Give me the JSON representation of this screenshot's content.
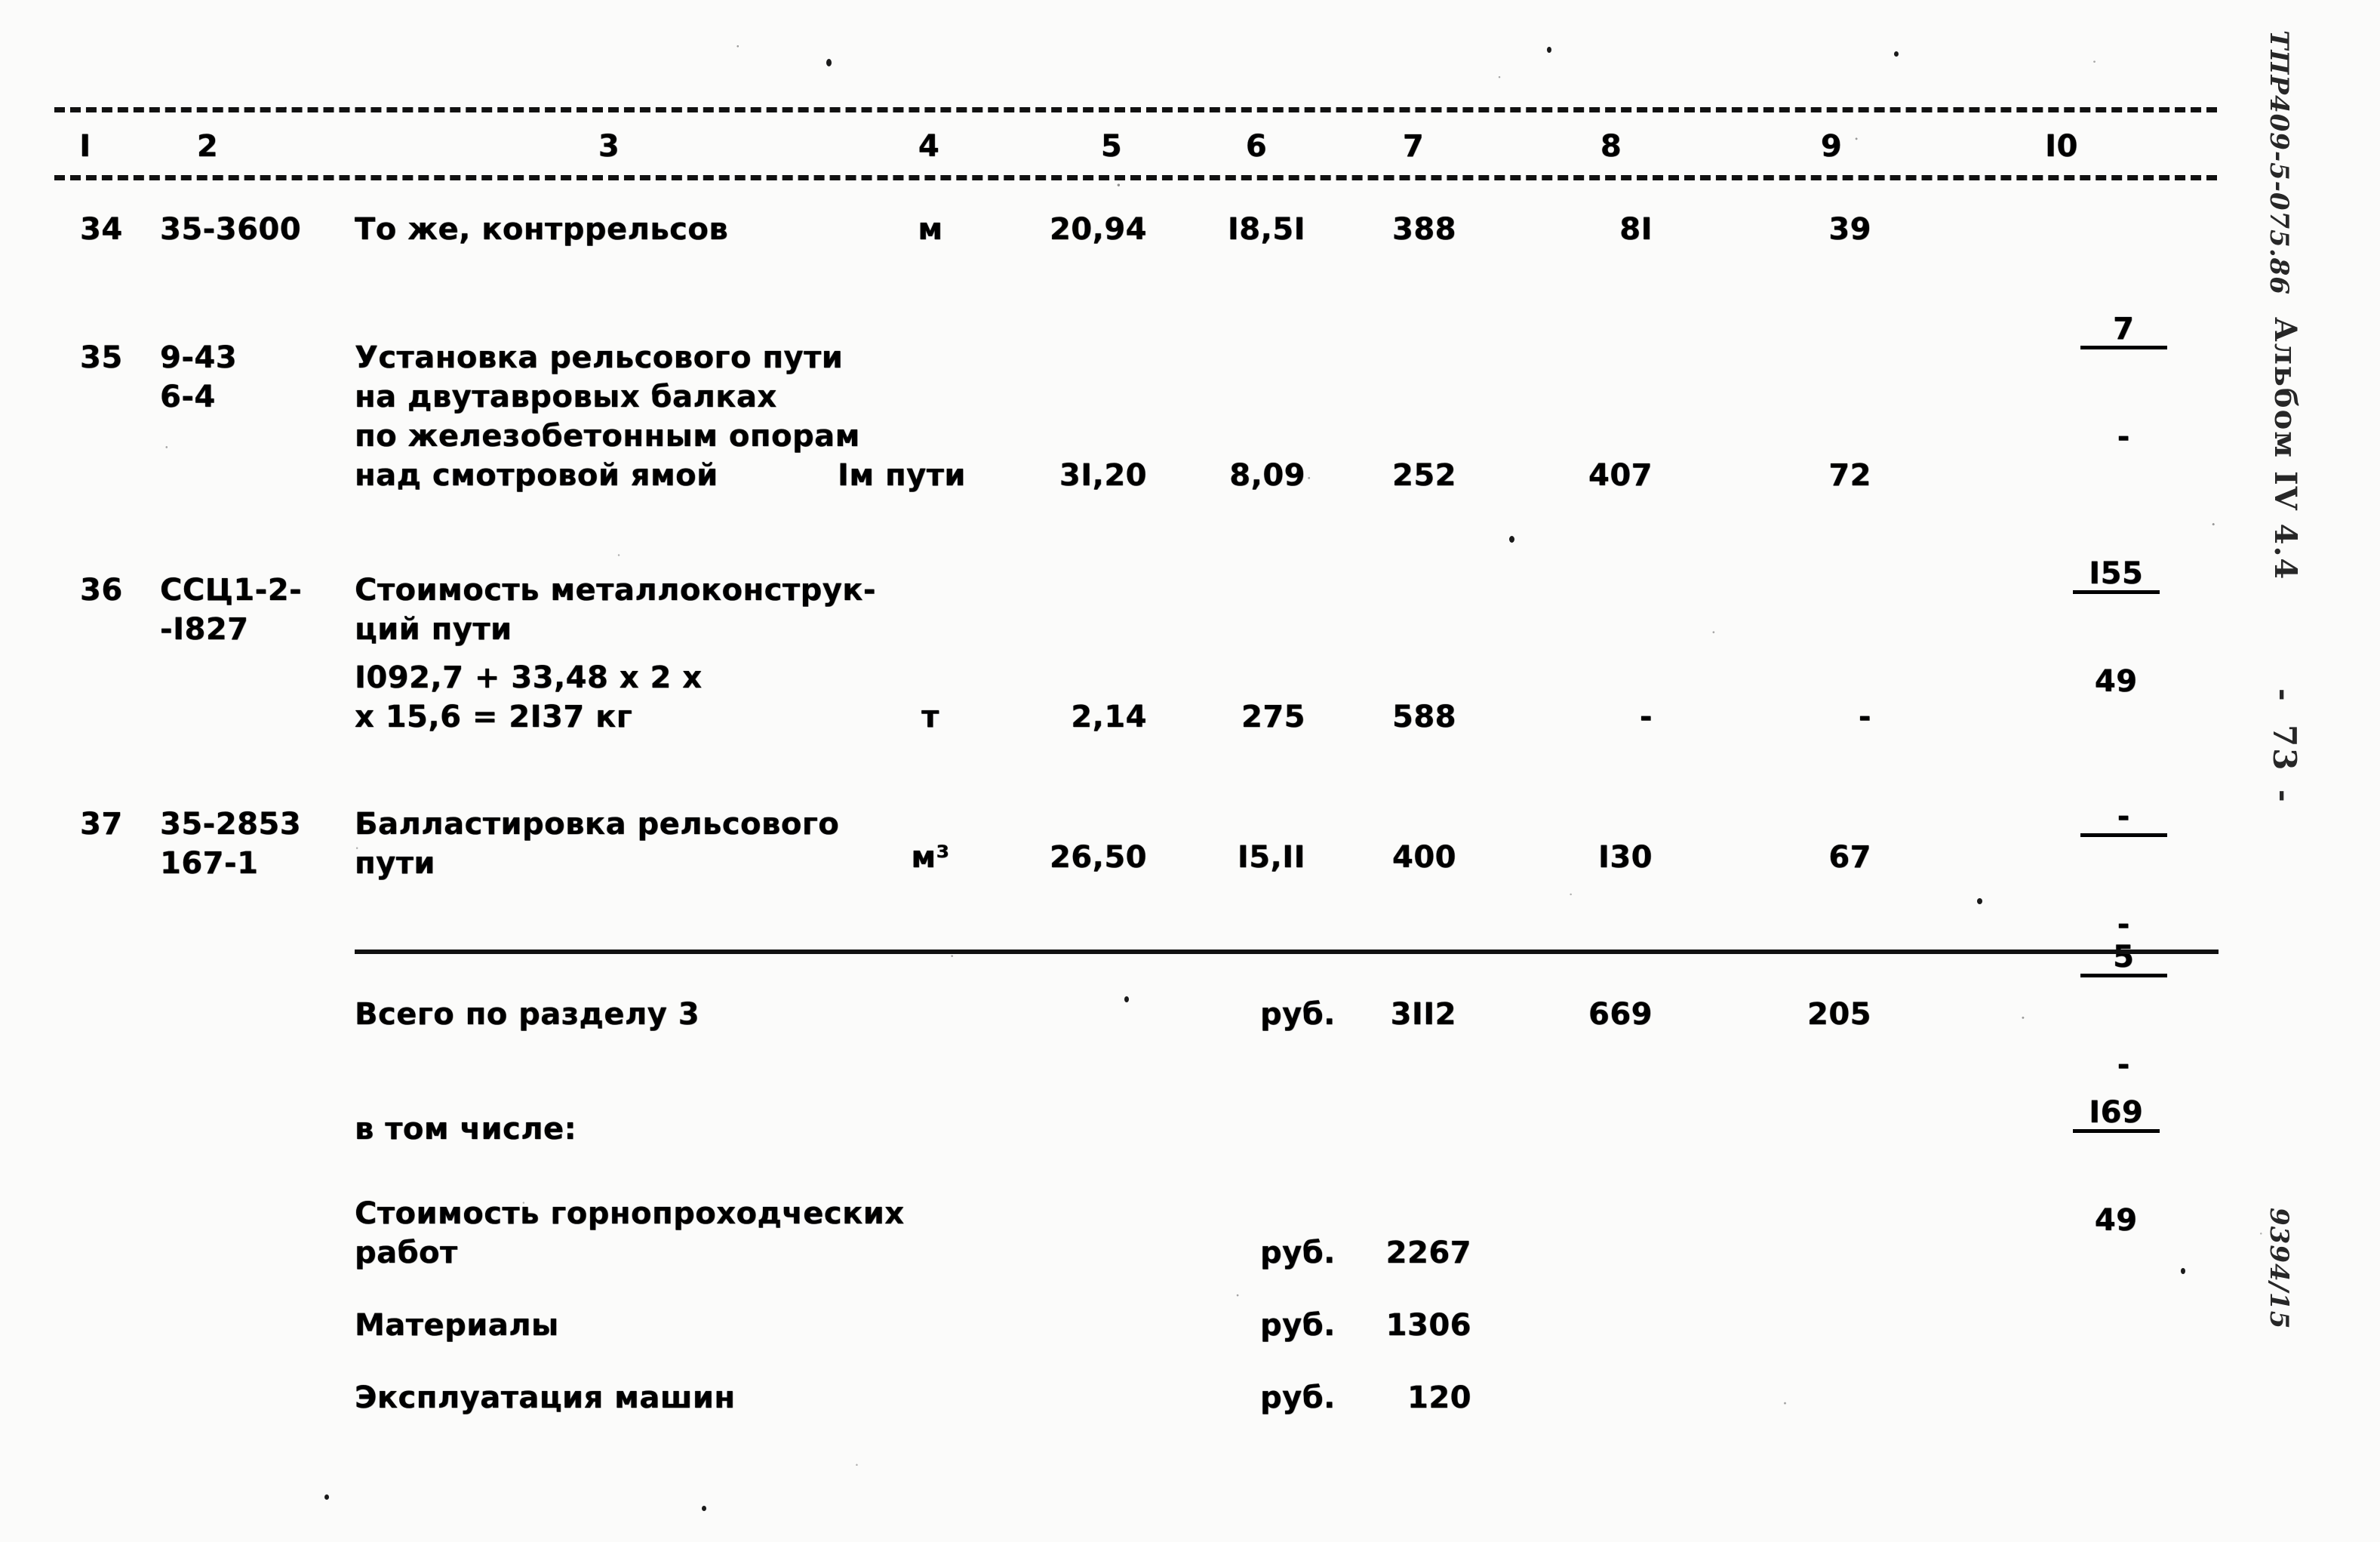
{
  "document": {
    "type": "scanned-estimate-table",
    "language": "ru"
  },
  "table": {
    "column_headers": [
      "I",
      "2",
      "3",
      "4",
      "5",
      "6",
      "7",
      "8",
      "9",
      "I0"
    ],
    "rows": [
      {
        "no": "34",
        "code_lines": [
          "35-3600"
        ],
        "desc_lines": [
          "То же, контррельсов"
        ],
        "unit": "м",
        "c5": "20,94",
        "c6": "I8,5I",
        "c7": "388",
        "c8": "8I",
        "c9": "39",
        "c10_top": "7",
        "c10_bot": "-"
      },
      {
        "no": "35",
        "code_lines": [
          "9-43",
          "6-4"
        ],
        "desc_lines": [
          "Установка рельсового пути",
          "на двутавровых балках",
          "по железобетонным опорам",
          "над смотровой ямой"
        ],
        "unit": "Iм пути",
        "c5": "3I,20",
        "c6": "8,09",
        "c7": "252",
        "c8": "407",
        "c9": "72",
        "c10_top": "I55",
        "c10_bot": "49"
      },
      {
        "no": "36",
        "code_lines": [
          "ССЦ1-2-",
          "-I827"
        ],
        "desc_lines": [
          "Стоимость металлоконструк-",
          "ций пути"
        ],
        "formula_lines": [
          "I092,7 + 33,48 x 2 x",
          "x 15,6 = 2I37 кг"
        ],
        "unit": "т",
        "c5": "2,14",
        "c6": "275",
        "c7": "588",
        "c8": "-",
        "c9": "-",
        "c10_top": "-",
        "c10_bot": "-"
      },
      {
        "no": "37",
        "code_lines": [
          "35-2853",
          "167-1"
        ],
        "desc_lines": [
          "Балластировка рельсового",
          "пути"
        ],
        "unit": "м³",
        "c5": "26,50",
        "c6": "I5,II",
        "c7": "400",
        "c8": "I30",
        "c9": "67",
        "c10_top": "5",
        "c10_bot": "-"
      }
    ],
    "total_row": {
      "label": "Всего по разделу 3",
      "unit": "руб.",
      "c7": "3II2",
      "c8": "669",
      "c9": "205",
      "c10_top": "I69",
      "c10_bot": "49"
    },
    "breakdown_title": "в том числе:",
    "breakdown": [
      {
        "label_lines": [
          "Стоимость горнопроходческих",
          "работ"
        ],
        "unit": "руб.",
        "value": "2267"
      },
      {
        "label_lines": [
          "Материалы"
        ],
        "unit": "руб.",
        "value": "1306"
      },
      {
        "label_lines": [
          "Эксплуатация машин"
        ],
        "unit": "руб.",
        "value": "120"
      }
    ]
  },
  "margin_notes": {
    "stamp": "ТПР409-5-075.86",
    "album": "Альбом IV 4.4",
    "dash_left": "-",
    "page": "73",
    "dash_right": "-",
    "reference": "9394/15"
  }
}
